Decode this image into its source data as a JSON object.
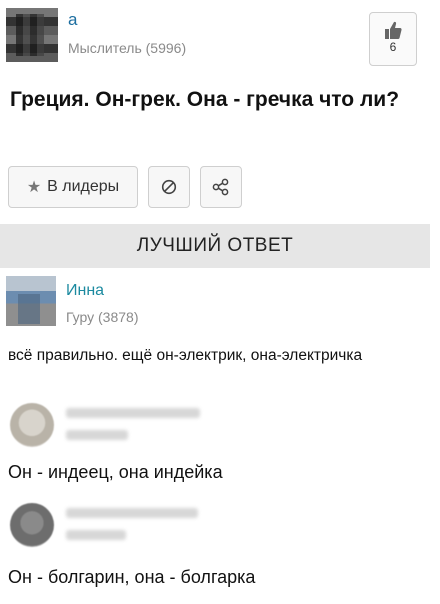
{
  "question": {
    "author_name": "а",
    "author_rank": "Мыслитель (5996)",
    "likes": "6",
    "title": "Греция. Он-грек. Она - гречка что ли?"
  },
  "actions": {
    "leaders_label": "В лидеры",
    "icons": [
      "star-icon",
      "block-icon",
      "share-icon",
      "thumbs-up-icon"
    ]
  },
  "best_answer": {
    "header": "ЛУЧШИЙ ОТВЕТ",
    "author_name": "Инна",
    "author_rank": "Гуру (3878)",
    "text": "всё правильно. ещё он-электрик, она-электричка"
  },
  "comments": [
    {
      "text": "Он - индеец, она индейка"
    },
    {
      "text": "Он - болгарин, она - болгарка"
    }
  ],
  "colors": {
    "link": "#1c6ea0",
    "rank": "#8a8a8a",
    "header_bg": "#e6e6e6"
  }
}
